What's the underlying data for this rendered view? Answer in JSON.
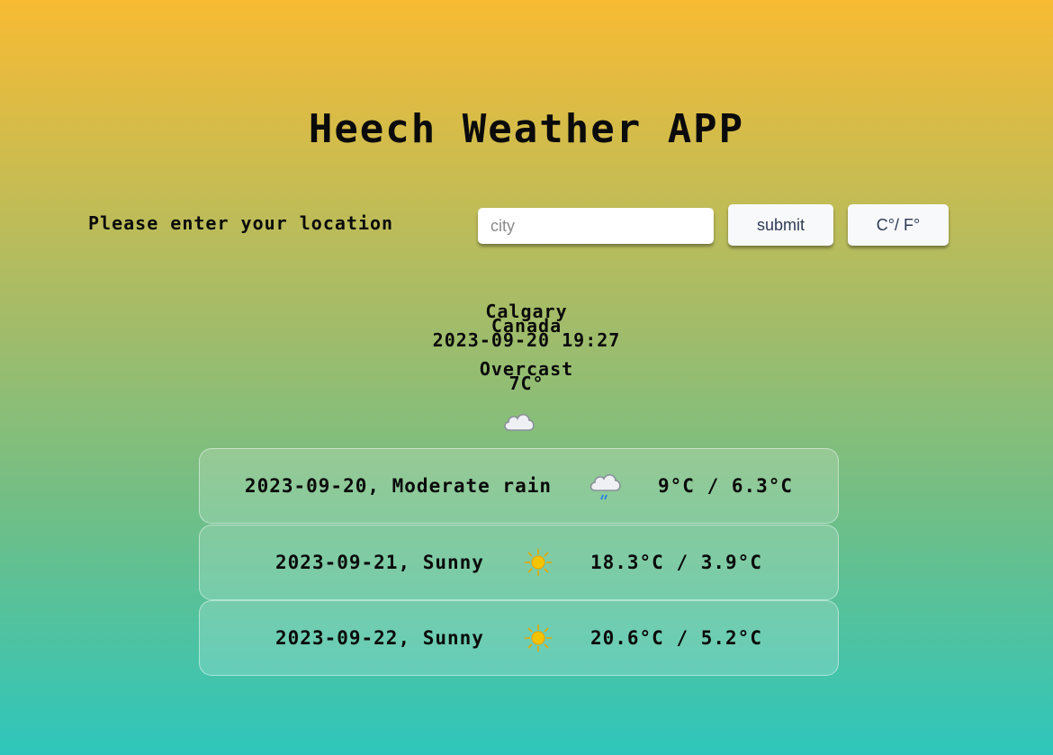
{
  "app": {
    "title": "Heech Weather APP"
  },
  "search": {
    "label": "Please enter your location",
    "placeholder": "city",
    "value": "",
    "submit_label": "submit",
    "unit_toggle_label": "C°/ F°"
  },
  "current": {
    "city": "Calgary",
    "country": "Canada",
    "local_time": "2023-09-20 19:27",
    "condition": "Overcast",
    "temperature": "7C°",
    "icon": "cloud-icon"
  },
  "forecast": [
    {
      "summary": "2023-09-20, Moderate rain",
      "icon": "rain-cloud-icon",
      "temps": "9°C / 6.3°C"
    },
    {
      "summary": "2023-09-21, Sunny",
      "icon": "sun-icon",
      "temps": "18.3°C / 3.9°C"
    },
    {
      "summary": "2023-09-22, Sunny",
      "icon": "sun-icon",
      "temps": "20.6°C / 5.2°C"
    }
  ],
  "colors": {
    "gradient_top": "#f8bb33",
    "gradient_bottom": "#2ec6bc",
    "sun": "#f5c400",
    "cloud": "#eef0f4",
    "rain": "#2b7fe0"
  }
}
